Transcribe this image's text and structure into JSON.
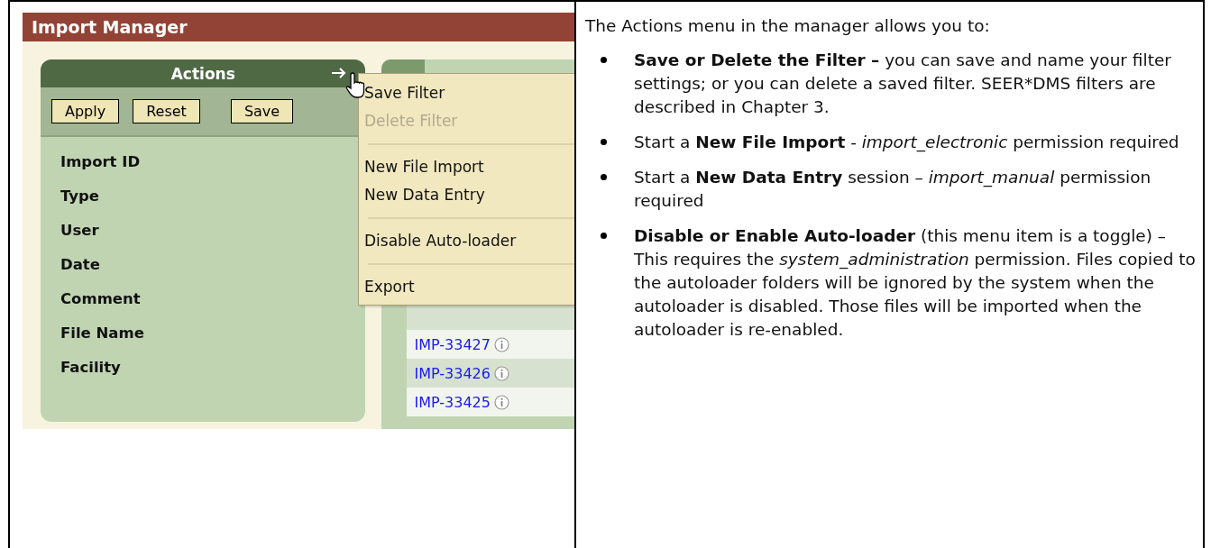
{
  "app_screenshot": {
    "window_title": "Import Manager",
    "actions_panel": {
      "title": "Actions",
      "buttons": [
        "Apply",
        "Reset",
        "Save"
      ],
      "fields": [
        "Import ID",
        "Type",
        "User",
        "Date",
        "Comment",
        "File Name",
        "Facility"
      ]
    },
    "results_panel": {
      "rows": [
        "IMP-33427",
        "IMP-33426",
        "IMP-33425"
      ]
    },
    "actions_menu": {
      "items": [
        {
          "kind": "item",
          "label": "Save Filter",
          "disabled": false
        },
        {
          "kind": "item",
          "label": "Delete Filter",
          "disabled": true
        },
        {
          "kind": "separator"
        },
        {
          "kind": "item",
          "label": "New File Import",
          "disabled": false
        },
        {
          "kind": "item",
          "label": "New Data Entry",
          "disabled": false
        },
        {
          "kind": "separator"
        },
        {
          "kind": "item",
          "label": "Disable Auto-loader",
          "disabled": false
        },
        {
          "kind": "separator"
        },
        {
          "kind": "item",
          "label": "Export",
          "disabled": false
        }
      ]
    }
  },
  "description": {
    "intro": "The Actions menu in the manager allows you to:",
    "bullets": [
      "**Save or Delete the Filter –** you can save and name your filter settings;  or you can delete a saved filter.  SEER*DMS filters are described in Chapter 3.",
      "Start a **New File Import** - *import_electronic* permission required",
      "Start a **New Data Entry** session – *import_manual* permission required",
      "**Disable or Enable Auto-loader** (this menu item is a toggle) – This requires the *system_administration* permission.  Files copied to the autoloader folders will be ignored by the system when the autoloader is disabled.  Those files will be imported when the autoloader is re-enabled."
    ]
  }
}
